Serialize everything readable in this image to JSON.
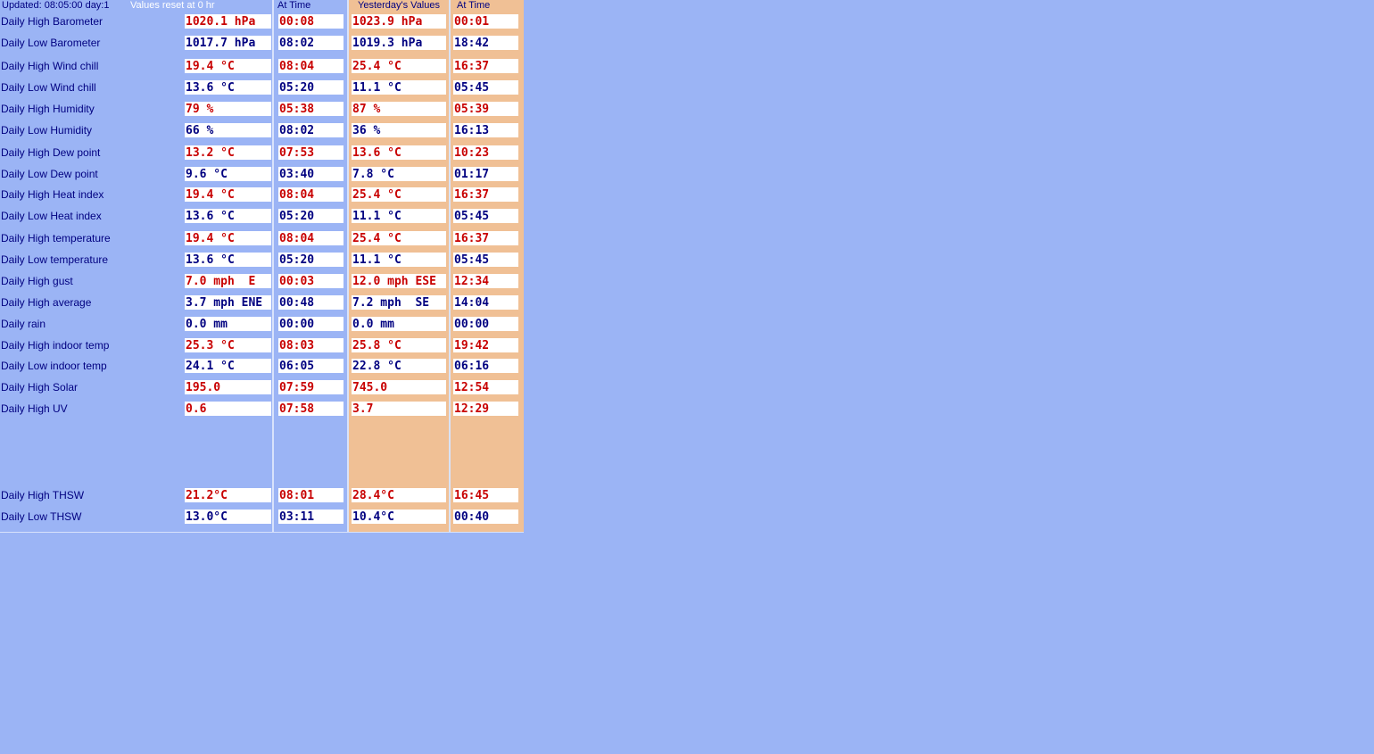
{
  "header": {
    "updated": "Updated: 08:05:00 day:1",
    "reset_note": "Values reset at 0 hr",
    "at_time_1": "At Time",
    "yesterday": "Yesterday's Values",
    "at_time_2": "At Time"
  },
  "colors": {
    "background": "#9bb4f5",
    "yesterday_band": "#f0c095",
    "high": "#c80000",
    "low": "#000080"
  },
  "rows": [
    {
      "label": "Daily High Barometer",
      "today": "1020.1 hPa",
      "today_time": "00:08",
      "yest": "1023.9 hPa",
      "yest_time": "00:01",
      "tone": "red"
    },
    {
      "label": "Daily Low Barometer",
      "today": "1017.7 hPa",
      "today_time": "08:02",
      "yest": "1019.3 hPa",
      "yest_time": "18:42",
      "tone": "blue"
    },
    {
      "label": "Daily High Wind chill",
      "today": "19.4 °C",
      "today_time": "08:04",
      "yest": "25.4 °C",
      "yest_time": "16:37",
      "tone": "red"
    },
    {
      "label": "Daily Low Wind chill",
      "today": "13.6 °C",
      "today_time": "05:20",
      "yest": "11.1 °C",
      "yest_time": "05:45",
      "tone": "blue"
    },
    {
      "label": "Daily High Humidity",
      "today": "79 %",
      "today_time": "05:38",
      "yest": "87 %",
      "yest_time": "05:39",
      "tone": "red"
    },
    {
      "label": "Daily Low Humidity",
      "today": "66 %",
      "today_time": "08:02",
      "yest": "36 %",
      "yest_time": "16:13",
      "tone": "blue"
    },
    {
      "label": "Daily High Dew point",
      "today": "13.2 °C",
      "today_time": "07:53",
      "yest": "13.6 °C",
      "yest_time": "10:23",
      "tone": "red"
    },
    {
      "label": "Daily Low Dew point",
      "today": "9.6 °C",
      "today_time": "03:40",
      "yest": "7.8 °C",
      "yest_time": "01:17",
      "tone": "blue"
    },
    {
      "label": "Daily High Heat index",
      "today": "19.4 °C",
      "today_time": "08:04",
      "yest": "25.4 °C",
      "yest_time": "16:37",
      "tone": "red"
    },
    {
      "label": "Daily Low Heat index",
      "today": "13.6 °C",
      "today_time": "05:20",
      "yest": "11.1 °C",
      "yest_time": "05:45",
      "tone": "blue"
    },
    {
      "label": "Daily High temperature",
      "today": "19.4 °C",
      "today_time": "08:04",
      "yest": "25.4 °C",
      "yest_time": "16:37",
      "tone": "red"
    },
    {
      "label": "Daily Low temperature",
      "today": "13.6 °C",
      "today_time": "05:20",
      "yest": "11.1 °C",
      "yest_time": "05:45",
      "tone": "blue"
    },
    {
      "label": "Daily High gust",
      "today": "7.0 mph  E",
      "today_time": "00:03",
      "yest": "12.0 mph ESE",
      "yest_time": "12:34",
      "tone": "red"
    },
    {
      "label": "Daily High average",
      "today": "3.7 mph ENE",
      "today_time": "00:48",
      "yest": "7.2 mph  SE",
      "yest_time": "14:04",
      "tone": "blue"
    },
    {
      "label": "Daily rain",
      "today": "0.0 mm",
      "today_time": "00:00",
      "yest": "0.0 mm",
      "yest_time": "00:00",
      "tone": "blue"
    },
    {
      "label": "Daily High indoor temp",
      "today": "25.3 °C",
      "today_time": "08:03",
      "yest": "25.8 °C",
      "yest_time": "19:42",
      "tone": "red"
    },
    {
      "label": "Daily Low indoor temp",
      "today": "24.1 °C",
      "today_time": "06:05",
      "yest": "22.8 °C",
      "yest_time": "06:16",
      "tone": "blue"
    },
    {
      "label": "Daily High Solar",
      "today": "195.0",
      "today_time": "07:59",
      "yest": "745.0",
      "yest_time": "12:54",
      "tone": "red"
    },
    {
      "label": "Daily High UV",
      "today": "0.6",
      "today_time": "07:58",
      "yest": "3.7",
      "yest_time": "12:29",
      "tone": "red"
    },
    {
      "label": "Daily High THSW",
      "today": "21.2°C",
      "today_time": "08:01",
      "yest": "28.4°C",
      "yest_time": "16:45",
      "tone": "red"
    },
    {
      "label": "Daily Low THSW",
      "today": "13.0°C",
      "today_time": "03:11",
      "yest": "10.4°C",
      "yest_time": "00:40",
      "tone": "blue"
    }
  ]
}
